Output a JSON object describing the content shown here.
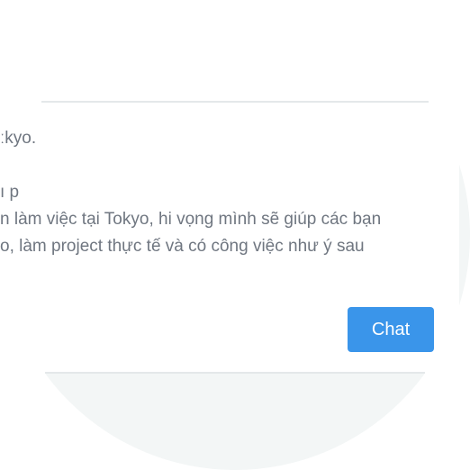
{
  "message": {
    "line1": "ːkyo.",
    "line2": "ı p",
    "line3": "n làm việc tại Tokyo, hi vọng mình sẽ giúp các bạn",
    "line4": "o, làm project thực tế và có công việc như ý sau"
  },
  "actions": {
    "chat_label": "Chat"
  },
  "colors": {
    "accent": "#3a95ea",
    "text": "#6f7680",
    "background_circle": "#f3f6f6",
    "divider": "#e4e8ea"
  }
}
